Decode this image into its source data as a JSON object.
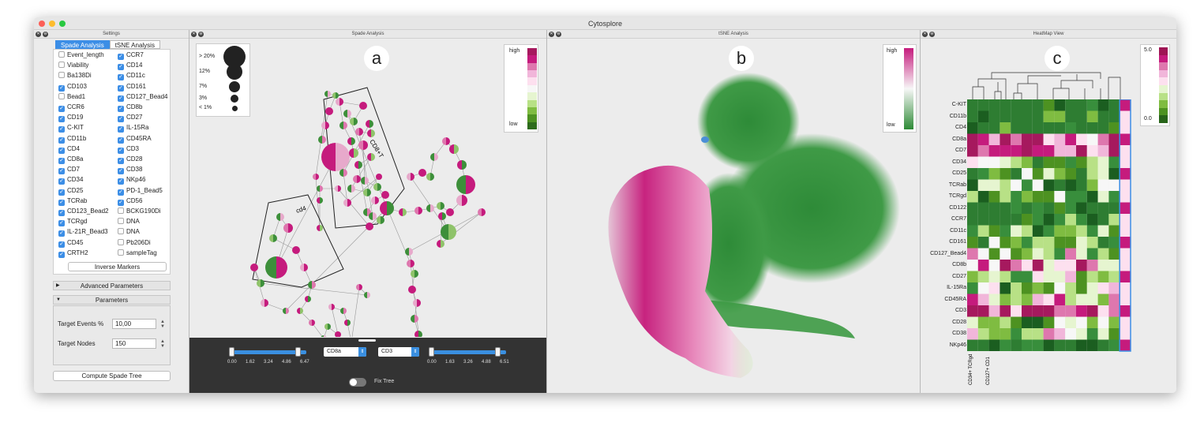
{
  "app_title": "Cytosplore",
  "panels": {
    "settings": "Settings",
    "spade": "Spade Analysis",
    "tsne": "tSNE Analysis",
    "heatmap": "HeatMap View"
  },
  "tabs": {
    "spade": "Spade Analysis",
    "tsne": "tSNE Analysis"
  },
  "markers": [
    {
      "l": "Event_length",
      "c": false,
      "r": "CCR7",
      "rc": true
    },
    {
      "l": "Viability",
      "c": false,
      "r": "CD14",
      "rc": true
    },
    {
      "l": "Ba138Di",
      "c": false,
      "r": "CD11c",
      "rc": true
    },
    {
      "l": "CD103",
      "c": true,
      "r": "CD161",
      "rc": true
    },
    {
      "l": "Bead1",
      "c": false,
      "r": "CD127_Bead4",
      "rc": true
    },
    {
      "l": "CCR6",
      "c": true,
      "r": "CD8b",
      "rc": true
    },
    {
      "l": "CD19",
      "c": true,
      "r": "CD27",
      "rc": true
    },
    {
      "l": "C-KIT",
      "c": true,
      "r": "IL-15Ra",
      "rc": true
    },
    {
      "l": "CD11b",
      "c": true,
      "r": "CD45RA",
      "rc": true
    },
    {
      "l": "CD4",
      "c": true,
      "r": "CD3",
      "rc": true
    },
    {
      "l": "CD8a",
      "c": true,
      "r": "CD28",
      "rc": true
    },
    {
      "l": "CD7",
      "c": true,
      "r": "CD38",
      "rc": true
    },
    {
      "l": "CD34",
      "c": true,
      "r": "NKp46",
      "rc": true
    },
    {
      "l": "CD25",
      "c": true,
      "r": "PD-1_Bead5",
      "rc": true
    },
    {
      "l": "TCRab",
      "c": true,
      "r": "CD56",
      "rc": true
    },
    {
      "l": "CD123_Bead2",
      "c": true,
      "r": "BCKG190Di",
      "rc": false
    },
    {
      "l": "TCRgd",
      "c": true,
      "r": "DNA",
      "rc": false
    },
    {
      "l": "IL-21R_Bead3",
      "c": true,
      "r": "DNA",
      "rc": false
    },
    {
      "l": "CD45",
      "c": true,
      "r": "Pb206Di",
      "rc": false
    },
    {
      "l": "CRTH2",
      "c": true,
      "r": "sampleTag",
      "rc": false
    }
  ],
  "inverse_markers": "Inverse Markers",
  "advanced_parameters": "Advanced Parameters",
  "parameters": "Parameters",
  "target_events_label": "Target Events %",
  "target_events": "10,00",
  "target_nodes_label": "Target Nodes",
  "target_nodes": "150",
  "compute": "Compute Spade Tree",
  "size_legend": [
    "> 20%",
    "12%",
    "7%",
    "3%",
    "< 1%"
  ],
  "color_legend": {
    "high": "high",
    "low": "low"
  },
  "heat_legend": {
    "max": "5.0",
    "min": "0.0"
  },
  "labels": {
    "a": "a",
    "b": "b",
    "c": "c",
    "cd8t": "CD8+T",
    "cd4": "cd4"
  },
  "slider1_ticks": [
    "0.00",
    "1.62",
    "3.24",
    "4.86",
    "6.47"
  ],
  "slider2_ticks": [
    "0.00",
    "1.63",
    "3.26",
    "4.88",
    "6.51"
  ],
  "select1": "CD8a",
  "select2": "CD3",
  "fix_tree": "Fix Tree",
  "heat_rows": [
    "C-KIT",
    "CD11b",
    "CD4",
    "CD8a",
    "CD7",
    "CD34",
    "CD25",
    "TCRab",
    "TCRgd",
    "CD122",
    "CCR7",
    "CD11c",
    "CD161",
    "CD127_Bead4",
    "CD8b",
    "CD27",
    "IL-15Ra",
    "CD45RA",
    "CD3",
    "CD28",
    "CD38",
    "NKp46"
  ],
  "heat_col_labels": [
    "CD34+ TCRgd",
    "CD127+ CD1"
  ],
  "colors": {
    "accent": "#3c8ee6",
    "magenta": "#c51b7d",
    "green": "#2d8a35"
  }
}
